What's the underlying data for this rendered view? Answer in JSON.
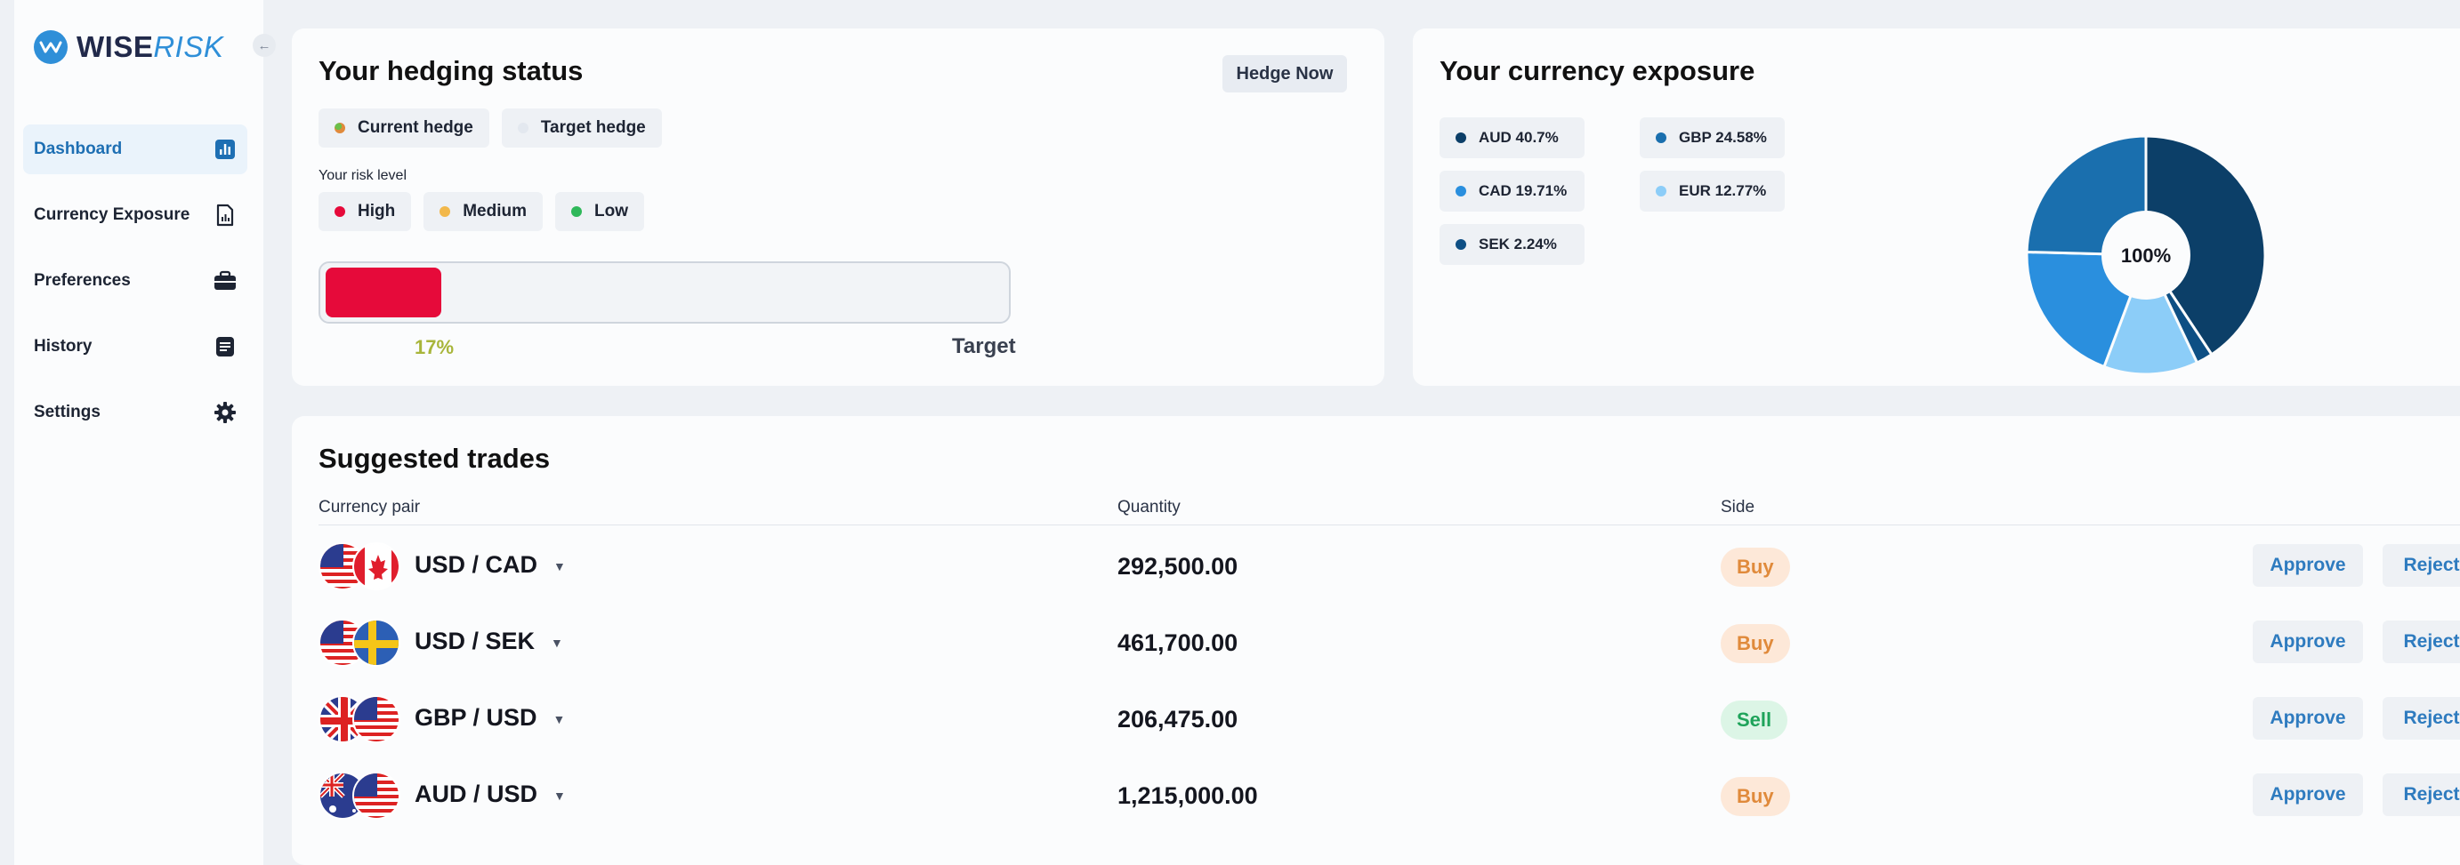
{
  "app": {
    "logo_main": "WISE",
    "logo_accent": "RISK",
    "collapse_icon": "arrow-left-icon"
  },
  "sidebar": {
    "items": [
      {
        "label": "Dashboard",
        "icon": "bar-chart-icon",
        "active": true
      },
      {
        "label": "Currency Exposure",
        "icon": "document-chart-icon",
        "active": false
      },
      {
        "label": "Preferences",
        "icon": "briefcase-icon",
        "active": false
      },
      {
        "label": "History",
        "icon": "list-icon",
        "active": false
      },
      {
        "label": "Settings",
        "icon": "gear-icon",
        "active": false
      }
    ]
  },
  "hedging": {
    "title": "Your hedging status",
    "hedge_now_label": "Hedge Now",
    "legend": [
      {
        "label": "Current hedge",
        "color": "#e08a3b"
      },
      {
        "label": "Target hedge",
        "color": "#e3e8ef"
      }
    ],
    "risk_level_label": "Your risk level",
    "risk_levels": [
      {
        "label": "High",
        "color": "#e60a3a"
      },
      {
        "label": "Medium",
        "color": "#f2b84b"
      },
      {
        "label": "Low",
        "color": "#2fb85a"
      }
    ],
    "progress_fraction": 0.17,
    "progress_label": "17%",
    "target_label": "Target"
  },
  "exposure": {
    "title": "Your currency exposure",
    "center_label": "100%",
    "items": [
      {
        "label": "AUD 40.7%",
        "color": "#0c3f68"
      },
      {
        "label": "GBP 24.58%",
        "color": "#1a6fae"
      },
      {
        "label": "CAD 19.71%",
        "color": "#2a8fde"
      },
      {
        "label": "EUR 12.77%",
        "color": "#8ccdf8"
      },
      {
        "label": "SEK 2.24%",
        "color": "#0e4f84"
      }
    ]
  },
  "chart_data": {
    "type": "pie",
    "categories": [
      "AUD",
      "SEK",
      "EUR",
      "CAD",
      "GBP"
    ],
    "values": [
      40.7,
      2.24,
      12.77,
      19.71,
      24.58
    ],
    "colors": [
      "#0c3f68",
      "#0e4f84",
      "#8ccdf8",
      "#2a8fde",
      "#1a6fae"
    ]
  },
  "trades": {
    "title": "Suggested trades",
    "columns": {
      "pair": "Currency pair",
      "quantity": "Quantity",
      "side": "Side"
    },
    "approve_label": "Approve",
    "reject_label": "Reject",
    "rows": [
      {
        "pair": "USD / CAD",
        "quantity": "292,500.00",
        "side": "Buy",
        "flags": [
          "us-flag",
          "canada-flag"
        ]
      },
      {
        "pair": "USD / SEK",
        "quantity": "461,700.00",
        "side": "Buy",
        "flags": [
          "us-flag",
          "sweden-flag"
        ]
      },
      {
        "pair": "GBP / USD",
        "quantity": "206,475.00",
        "side": "Sell",
        "flags": [
          "uk-flag",
          "us-flag"
        ]
      },
      {
        "pair": "AUD / USD",
        "quantity": "1,215,000.00",
        "side": "Buy",
        "flags": [
          "australia-flag",
          "us-flag"
        ]
      }
    ]
  }
}
